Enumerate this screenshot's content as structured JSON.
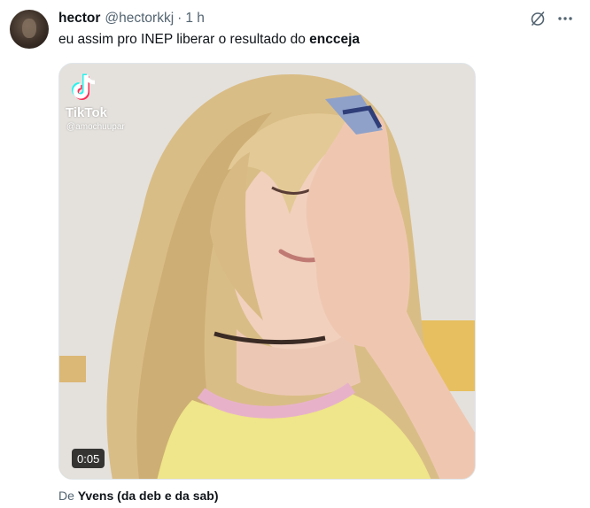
{
  "tweet": {
    "display_name": "hector",
    "handle": "@hectorkkj",
    "separator": "·",
    "time": "1 h",
    "text_before": "eu assim pro INEP liberar o resultado do ",
    "text_bold": "encceja"
  },
  "media": {
    "watermark_brand": "TikTok",
    "watermark_user": "@amochuupar",
    "duration": "0:05"
  },
  "attribution": {
    "prefix": "De ",
    "source": "Yvens (da deb e da sab)"
  },
  "icons": {
    "grok": "grok-icon",
    "more": "more-options-icon",
    "tiktok": "tiktok-logo-icon",
    "avatar": "user-avatar"
  },
  "colors": {
    "text": "#0f1419",
    "secondary_text": "#536471",
    "duration_bg": "#000000",
    "border": "#e1e6ea"
  }
}
